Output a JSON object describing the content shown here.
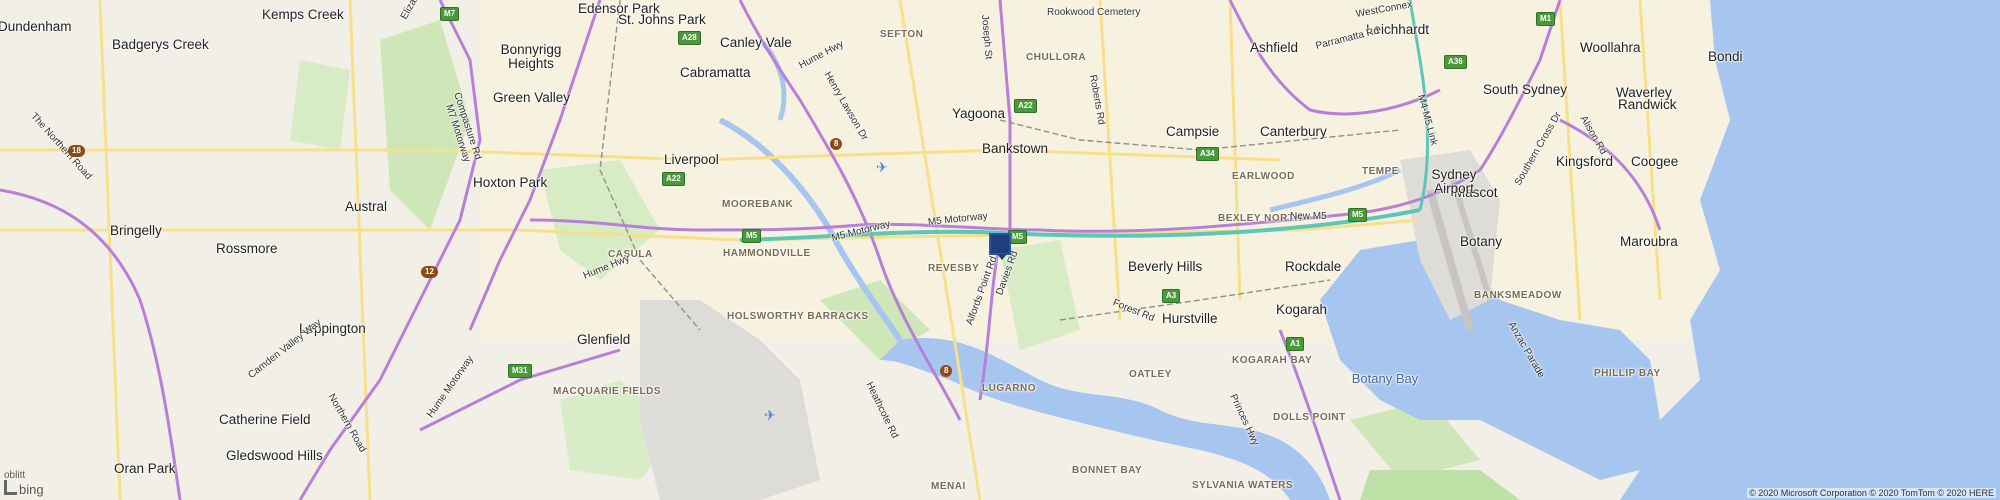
{
  "map": {
    "places": [
      {
        "name": "Kemps Creek",
        "cls": "big"
      },
      {
        "name": "Edensor Park",
        "cls": "big"
      },
      {
        "name": "St. Johns Park",
        "cls": "big"
      },
      {
        "name": "Badgerys Creek",
        "cls": "big"
      },
      {
        "name": "Canley Vale",
        "cls": "big"
      },
      {
        "name": "Bonnyrigg Heights",
        "cls": "big"
      },
      {
        "name": "Cabramatta",
        "cls": "big"
      },
      {
        "name": "Green Valley",
        "cls": "big"
      },
      {
        "name": "Yagoona",
        "cls": "big"
      },
      {
        "name": "Bankstown",
        "cls": "big"
      },
      {
        "name": "Liverpool",
        "cls": "big"
      },
      {
        "name": "Hoxton Park",
        "cls": "big"
      },
      {
        "name": "Austral",
        "cls": "big"
      },
      {
        "name": "Bringelly",
        "cls": "big"
      },
      {
        "name": "Rossmore",
        "cls": "big"
      },
      {
        "name": "Leppington",
        "cls": "big"
      },
      {
        "name": "Glenfield",
        "cls": "big"
      },
      {
        "name": "Catherine Field",
        "cls": "big"
      },
      {
        "name": "Gledswood Hills",
        "cls": "big"
      },
      {
        "name": "Oran Park",
        "cls": "big"
      },
      {
        "name": "Ashfield",
        "cls": "big"
      },
      {
        "name": "Leichhardt",
        "cls": "big"
      },
      {
        "name": "Campsie",
        "cls": "big"
      },
      {
        "name": "Canterbury",
        "cls": "big"
      },
      {
        "name": "Woollahra",
        "cls": "big"
      },
      {
        "name": "Bondi",
        "cls": "big"
      },
      {
        "name": "South Sydney",
        "cls": "big"
      },
      {
        "name": "Waverley",
        "cls": "big"
      },
      {
        "name": "Randwick",
        "cls": "big"
      },
      {
        "name": "Kingsford",
        "cls": "big"
      },
      {
        "name": "Coogee",
        "cls": "big"
      },
      {
        "name": "Mascot",
        "cls": "big"
      },
      {
        "name": "Sydney Airport",
        "cls": "big"
      },
      {
        "name": "Botany",
        "cls": "big"
      },
      {
        "name": "Maroubra",
        "cls": "big"
      },
      {
        "name": "Beverly Hills",
        "cls": "big"
      },
      {
        "name": "Rockdale",
        "cls": "big"
      },
      {
        "name": "Hurstville",
        "cls": "big"
      },
      {
        "name": "Kogarah",
        "cls": "big"
      },
      {
        "name": "Dundenham",
        "cls": "big"
      },
      {
        "name": "SEFTON",
        "cls": "sub"
      },
      {
        "name": "CHULLORA",
        "cls": "sub"
      },
      {
        "name": "MOOREBANK",
        "cls": "sub"
      },
      {
        "name": "CASULA",
        "cls": "sub"
      },
      {
        "name": "HAMMONDVILLE",
        "cls": "sub"
      },
      {
        "name": "REVESBY",
        "cls": "sub"
      },
      {
        "name": "HOLSWORTHY BARRACKS",
        "cls": "sub"
      },
      {
        "name": "MACQUARIE FIELDS",
        "cls": "sub"
      },
      {
        "name": "EARLWOOD",
        "cls": "sub"
      },
      {
        "name": "TEMPE",
        "cls": "sub"
      },
      {
        "name": "BEXLEY NORTH",
        "cls": "sub"
      },
      {
        "name": "LUGARNO",
        "cls": "sub"
      },
      {
        "name": "OATLEY",
        "cls": "sub"
      },
      {
        "name": "KOGARAH BAY",
        "cls": "sub"
      },
      {
        "name": "DOLLS POINT",
        "cls": "sub"
      },
      {
        "name": "BANKSMEADOW",
        "cls": "sub"
      },
      {
        "name": "PHILLIP BAY",
        "cls": "sub"
      },
      {
        "name": "BONNET BAY",
        "cls": "sub"
      },
      {
        "name": "SYLVANIA WATERS",
        "cls": "sub"
      },
      {
        "name": "MENAI",
        "cls": "sub"
      },
      {
        "name": "Rookwood Cemetery",
        "cls": "small"
      },
      {
        "name": "Botany Bay",
        "cls": "water"
      }
    ],
    "roads": [
      "M5 Motorway",
      "M5 Motorway",
      "New M5",
      "Hume Hwy",
      "Hume Hwy",
      "Henry Lawson Dr",
      "M7 Motorway",
      "Camden Valley Way",
      "Hume Motorway",
      "The Northern Road",
      "Northern Road",
      "Heathcote Rd",
      "Alfords Point Rd",
      "Davies Rd",
      "Roberts Rd",
      "Forest Rd",
      "Princes Hwy",
      "Anzac Parade",
      "Southern Cross Dr",
      "Alison Rd",
      "Parramatta Rd",
      "WestConnex",
      "M4-M5 Link",
      "Elizabeth Dr",
      "Compasture Rd",
      "Joseph St"
    ],
    "shields": [
      {
        "text": "M7",
        "color": "green"
      },
      {
        "text": "A28",
        "color": "green"
      },
      {
        "text": "A22",
        "color": "green"
      },
      {
        "text": "A22",
        "color": "green"
      },
      {
        "text": "M5",
        "color": "green"
      },
      {
        "text": "M5",
        "color": "green"
      },
      {
        "text": "M5",
        "color": "green"
      },
      {
        "text": "A34",
        "color": "green"
      },
      {
        "text": "A36",
        "color": "green"
      },
      {
        "text": "M1",
        "color": "green"
      },
      {
        "text": "A3",
        "color": "green"
      },
      {
        "text": "A1",
        "color": "green"
      },
      {
        "text": "M31",
        "color": "green"
      },
      {
        "text": "18",
        "color": "brown"
      },
      {
        "text": "12",
        "color": "brown"
      },
      {
        "text": "8",
        "color": "brown"
      },
      {
        "text": "8",
        "color": "brown"
      }
    ],
    "marker": {
      "label": "Location marker",
      "color": "#1f3f7a"
    },
    "colors": {
      "land": "#f2efe6",
      "water": "#a7c6ef",
      "park": "#cfe6b8",
      "motorway": "#b87fd8",
      "arterial": "#f7e08a"
    }
  },
  "branding": {
    "logo": "bing",
    "logo_prefix": "oblitt"
  },
  "attribution": "© 2020 Microsoft Corporation © 2020 TomTom © 2020 HERE"
}
